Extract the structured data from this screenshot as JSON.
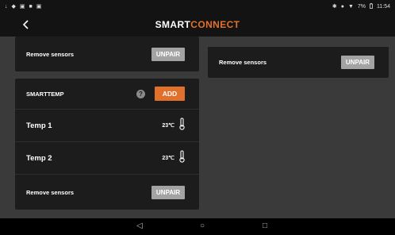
{
  "status": {
    "left_icons": [
      "↓",
      "◆",
      "▣",
      "■",
      "▣"
    ],
    "right_icons": [
      "✱",
      "●",
      "▼"
    ],
    "battery": "7%",
    "time": "11:54"
  },
  "header": {
    "back_icon": "chevron-left-icon",
    "brand_part1": "SMART",
    "brand_part2": "CONNECT",
    "accent_color": "#e1712a"
  },
  "left_top_card": {
    "remove_label": "Remove sensors",
    "unpair_label": "UNPAIR"
  },
  "right_card": {
    "remove_label": "Remove sensors",
    "unpair_label": "UNPAIR"
  },
  "smarttemp_card": {
    "title": "SMARTTEMP",
    "help_label": "?",
    "add_label": "ADD",
    "sensors": [
      {
        "name": "Temp 1",
        "value": "23℃"
      },
      {
        "name": "Temp 2",
        "value": "23℃"
      }
    ],
    "remove_label": "Remove sensors",
    "unpair_label": "UNPAIR"
  },
  "nav": {
    "back": "◁",
    "home": "○",
    "recents": "□"
  }
}
